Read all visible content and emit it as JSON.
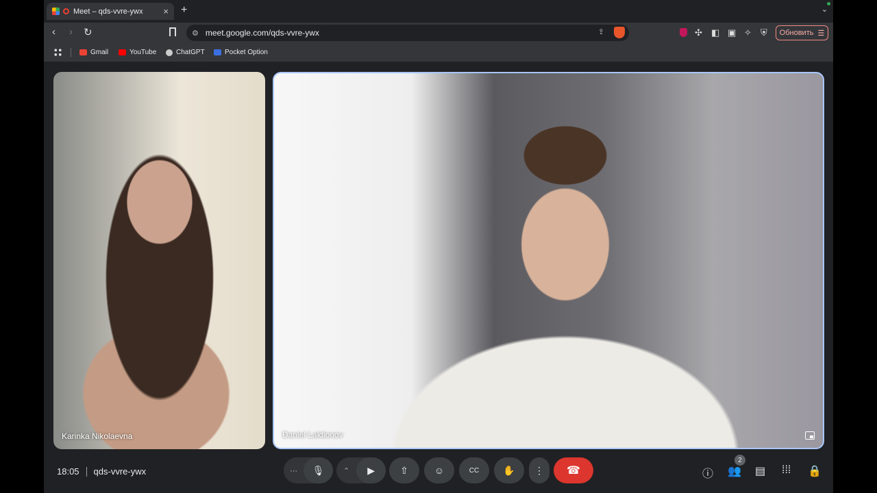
{
  "browser": {
    "tab": {
      "title": "Meet – qds-vvre-ywx",
      "close": "×"
    },
    "new_tab": "+",
    "tab_menu": "⌄",
    "toolbar": {
      "back": "‹",
      "forward": "›",
      "reload": "↻",
      "url": "meet.google.com/qds-vvre-ywx",
      "update_label": "Обновить"
    },
    "bookmarks": [
      {
        "label": "Gmail",
        "color": "#ea4335"
      },
      {
        "label": "YouTube",
        "color": "#ff0000"
      },
      {
        "label": "ChatGPT",
        "color": "#cccccc"
      },
      {
        "label": "Pocket Option",
        "color": "#3b6fe0"
      }
    ]
  },
  "meet": {
    "participants": [
      {
        "name": "Karinka Nikolaevna"
      },
      {
        "name": "Daniel Laktionov"
      }
    ],
    "time": "18:05",
    "meeting_code": "qds-vvre-ywx",
    "people_count": "2",
    "accent_color": "#a8c7fa",
    "end_call_color": "#dc362e"
  }
}
